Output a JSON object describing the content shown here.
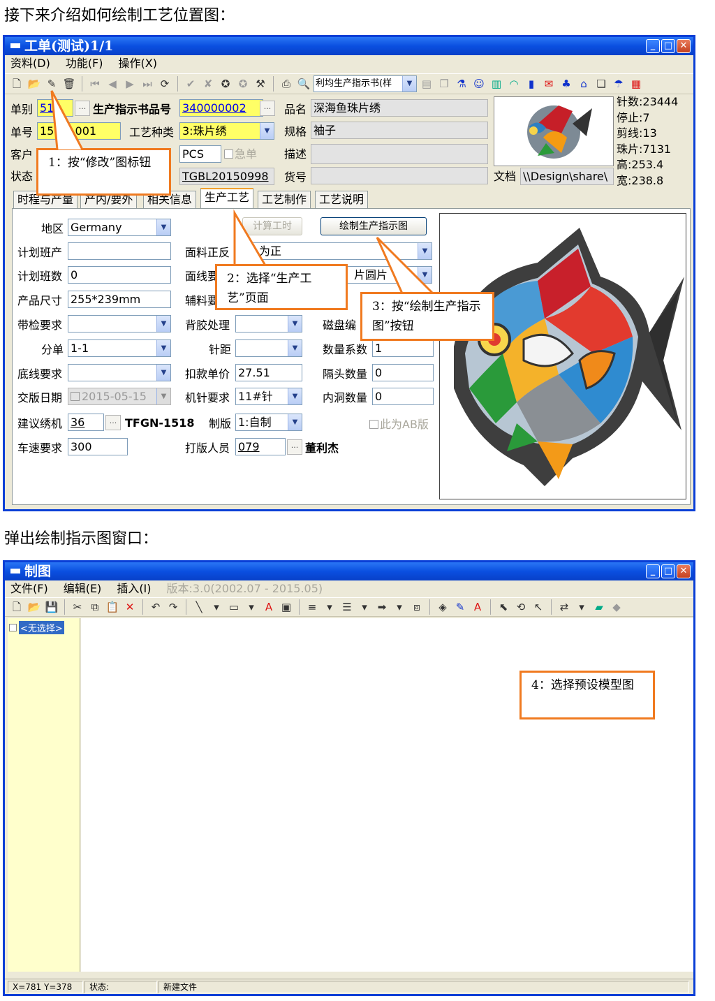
{
  "doc": {
    "intro": "接下来介绍如何绘制工艺位置图：",
    "popup": "弹出绘制指示图窗口："
  },
  "workorder": {
    "title": "工单(测试)1/1",
    "menu": [
      "资料(D)",
      "功能(F)",
      "操作(X)"
    ],
    "report_select": "利均生产指示书(样",
    "fields": {
      "dept_label": "单别",
      "dept_value": "510",
      "instr_label": "生产指示书品号",
      "instr_value": "340000002",
      "order_label": "单号",
      "order_value": "150",
      "order_value_tail": "001",
      "craft_type_label": "工艺种类",
      "craft_type_value": "3:珠片绣",
      "customer_label": "客户",
      "unit_value": "PCS",
      "urgent_label": "急单",
      "status_label": "状态",
      "tgbl_value": "TGBL20150998",
      "product_label": "品名",
      "product_value": "深海鱼珠片绣",
      "spec_label": "规格",
      "spec_value": "袖子",
      "desc_label": "描述",
      "goods_label": "货号",
      "file_label": "文档",
      "file_value": "\\\\Design\\share\\"
    },
    "stats": [
      "针数:23444",
      "停止:7",
      "剪线:13",
      "珠片:7131",
      "高:253.4",
      "宽:238.8"
    ],
    "tabs": [
      "时程与产量",
      "产内/要外",
      "相关信息",
      "生产工艺",
      "工艺制作",
      "工艺说明"
    ],
    "craft": {
      "region_label": "地区",
      "region_value": "Germany",
      "calc_button": "计算工时",
      "draw_button": "绘制生产指示图",
      "plan_prod_label": "计划班产",
      "plan_shift_label": "计划班数",
      "plan_shift_value": "0",
      "size_label": "产品尺寸",
      "size_value": "255*239mm",
      "belt_label": "带检要求",
      "split_label": "分单",
      "split_value": "1-1",
      "bottom_label": "底线要求",
      "release_label": "交版日期",
      "release_value": "2015-05-15",
      "machine_label": "建议绣机",
      "machine_value": "36",
      "machine_code": "TFGN-1518",
      "speed_label": "车速要求",
      "speed_value": "300",
      "fabric_side_label": "面料正反",
      "fabric_side_value": "为正",
      "face_req_label": "面线要",
      "face_req_value": "片圆片",
      "aux_label": "辅料要",
      "backing_label": "背胶处理",
      "needle_dist_label": "针距",
      "deduct_label": "扣款单价",
      "deduct_value": "27.51",
      "needle_req_label": "机针要求",
      "needle_req_value": "11#针",
      "plate_label": "制版",
      "plate_value": "1:自制",
      "proof_label": "打版人员",
      "proof_value": "079",
      "proof_name": "董利杰",
      "disk_label": "磁盘编",
      "qty_label": "数量系数",
      "qty_value": "1",
      "gap_label": "隔头数量",
      "gap_value": "0",
      "hole_label": "内洞数量",
      "hole_value": "0",
      "ab_label": "此为AB版"
    }
  },
  "callouts": {
    "c1": "1：按“修改”图标钮",
    "c2": "2：选择“生产工艺”页面",
    "c3": "3：按“绘制生产指示图”按钮",
    "c4": "4：选择预设模型图"
  },
  "drawwin": {
    "title": "制图",
    "menu": [
      "文件(F)",
      "编辑(E)",
      "插入(I)"
    ],
    "version": "版本:3.0(2002.07 - 2015.05)",
    "no_selection": "<无选择>",
    "status_coords": "X=781  Y=378",
    "status_label": "状态:",
    "status_value": "新建文件"
  },
  "colors": {
    "title_blue": "#0a3fd6",
    "callout_orange": "#f07a20",
    "highlight_yellow": "#ffff66",
    "sidebar_yellow": "#ffffcc"
  }
}
